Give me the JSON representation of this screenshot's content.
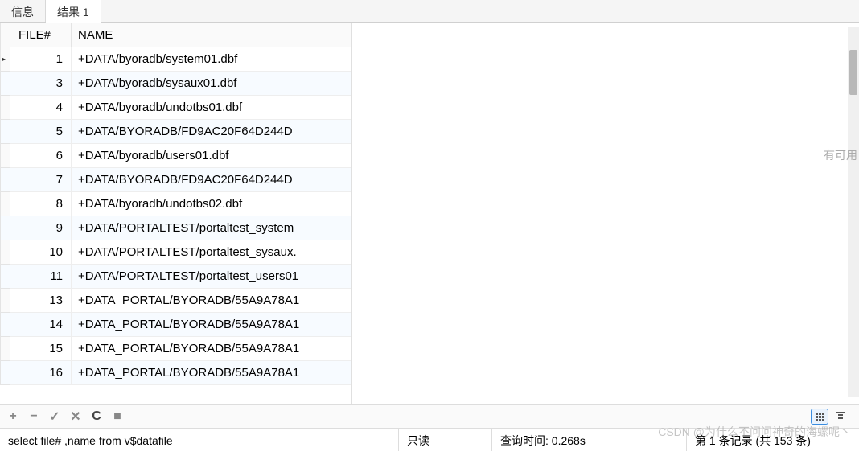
{
  "tabs": {
    "info": "信息",
    "result1": "结果 1"
  },
  "columns": {
    "file": "FILE#",
    "name": "NAME"
  },
  "rows": [
    {
      "file": "1",
      "name": "+DATA/byoradb/system01.dbf"
    },
    {
      "file": "3",
      "name": "+DATA/byoradb/sysaux01.dbf"
    },
    {
      "file": "4",
      "name": "+DATA/byoradb/undotbs01.dbf"
    },
    {
      "file": "5",
      "name": "+DATA/BYORADB/FD9AC20F64D244D"
    },
    {
      "file": "6",
      "name": "+DATA/byoradb/users01.dbf"
    },
    {
      "file": "7",
      "name": "+DATA/BYORADB/FD9AC20F64D244D"
    },
    {
      "file": "8",
      "name": "+DATA/byoradb/undotbs02.dbf"
    },
    {
      "file": "9",
      "name": "+DATA/PORTALTEST/portaltest_system"
    },
    {
      "file": "10",
      "name": "+DATA/PORTALTEST/portaltest_sysaux."
    },
    {
      "file": "11",
      "name": "+DATA/PORTALTEST/portaltest_users01"
    },
    {
      "file": "13",
      "name": "+DATA_PORTAL/BYORADB/55A9A78A1"
    },
    {
      "file": "14",
      "name": "+DATA_PORTAL/BYORADB/55A9A78A1"
    },
    {
      "file": "15",
      "name": "+DATA_PORTAL/BYORADB/55A9A78A1"
    },
    {
      "file": "16",
      "name": "+DATA_PORTAL/BYORADB/55A9A78A1"
    }
  ],
  "side_hint": "有可用",
  "toolbar": {
    "add": "+",
    "remove": "−",
    "confirm": "✓",
    "cancel": "✕",
    "refresh": "C",
    "stop": "■"
  },
  "statusbar": {
    "sql": "select  file# ,name  from v$datafile",
    "readonly": "只读",
    "query_time": "查询时间: 0.268s",
    "record": "第 1 条记录 (共 153 条)"
  },
  "watermark": "CSDN @为什么不问问神奇的海螺呢丶"
}
